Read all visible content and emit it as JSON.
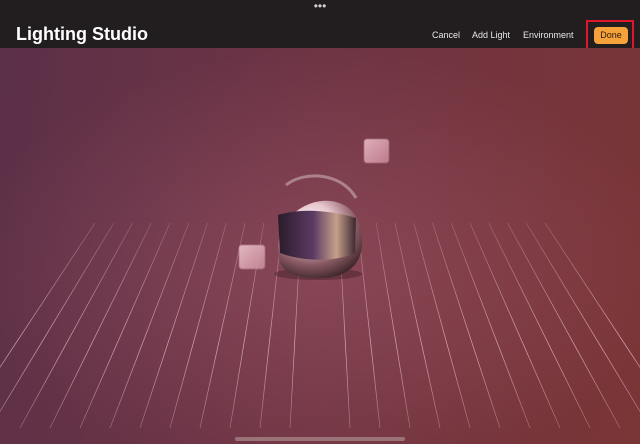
{
  "app": {
    "title": "Lighting Studio"
  },
  "topbar": {
    "multitask_glyph": "•••",
    "cancel_label": "Cancel",
    "add_light_label": "Add Light",
    "environment_label": "Environment",
    "done_label": "Done"
  },
  "colors": {
    "accent": "#f5a23a",
    "highlight": "#e0162b",
    "topbar_bg": "#221d1e",
    "grid_line": "#f3c9d8"
  },
  "scene": {
    "object": "helmet",
    "lights": [
      "light-cube-top",
      "light-cube-left"
    ]
  }
}
